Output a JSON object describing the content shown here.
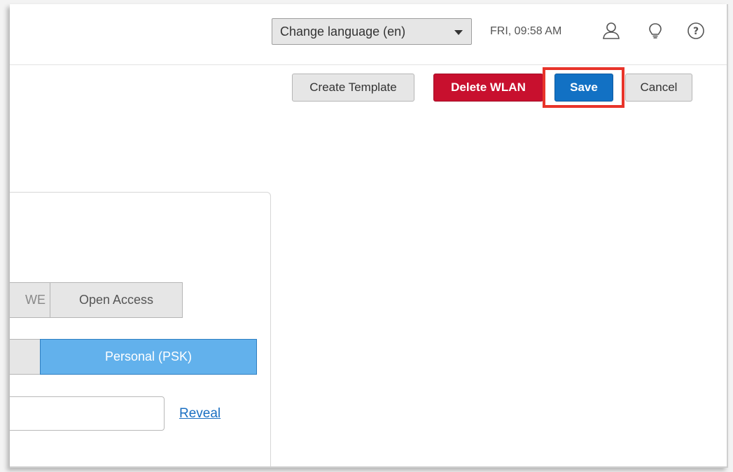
{
  "header": {
    "language_select": {
      "label": "Change language (en)"
    },
    "datetime": "FRI, 09:58 AM",
    "icons": [
      "user-icon",
      "lightbulb-icon",
      "help-icon"
    ]
  },
  "toolbar": {
    "create_template_label": "Create Template",
    "delete_wlan_label": "Delete WLAN",
    "save_label": "Save",
    "cancel_label": "Cancel"
  },
  "form": {
    "security_options": [
      "WE",
      "Open Access"
    ],
    "auth_mode": {
      "selected": "Personal (PSK)"
    },
    "passphrase": {
      "value": "",
      "reveal_label": "Reveal"
    }
  },
  "colors": {
    "save": "#1271c4",
    "delete": "#c8102e",
    "selected_segment": "#62b1ec",
    "highlight": "#e8342a",
    "link": "#1a6fc2"
  }
}
